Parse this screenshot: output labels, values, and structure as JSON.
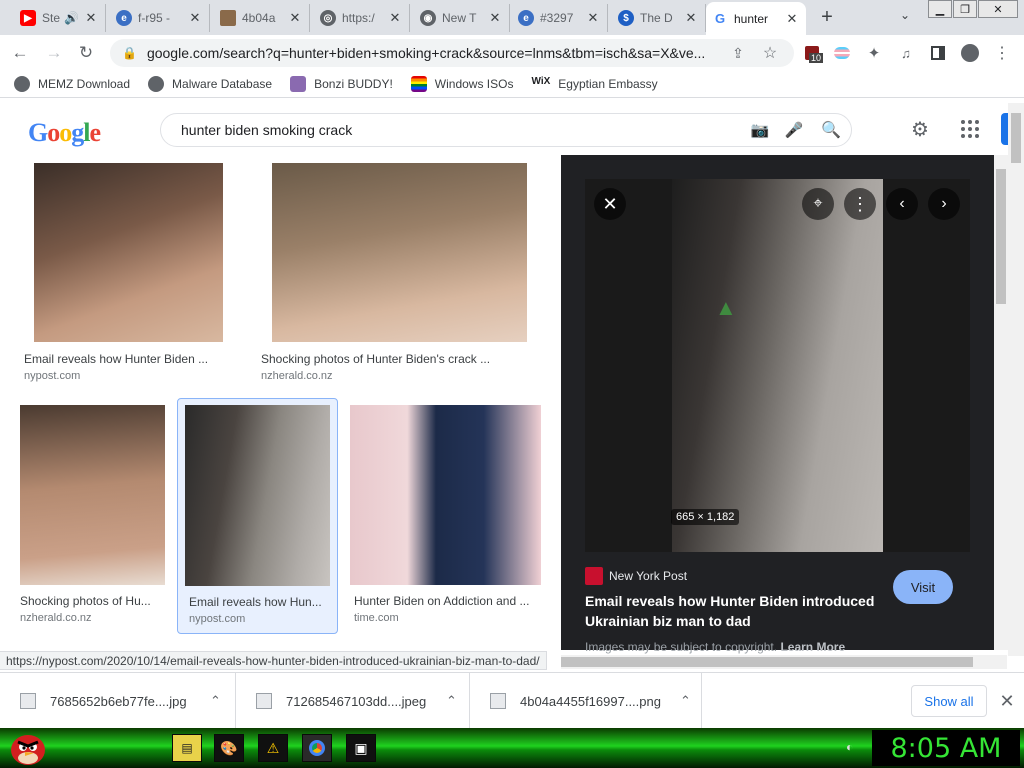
{
  "browser": {
    "tabs": [
      {
        "title": "Ste",
        "icon": "youtube-icon"
      },
      {
        "title": "f-r95 -",
        "icon": "site-icon"
      },
      {
        "title": "4b04a",
        "icon": "image-icon"
      },
      {
        "title": "https:/",
        "icon": "globe-icon"
      },
      {
        "title": "New T",
        "icon": "chrome-icon"
      },
      {
        "title": "#3297",
        "icon": "site-icon"
      },
      {
        "title": "The D",
        "icon": "dollar-icon"
      },
      {
        "title": "hunter",
        "icon": "google-icon"
      }
    ],
    "url": "google.com/search?q=hunter+biden+smoking+crack&source=lnms&tbm=isch&sa=X&ve...",
    "extension_badge": "10",
    "bookmarks": [
      {
        "label": "MEMZ Download"
      },
      {
        "label": "Malware Database"
      },
      {
        "label": "Bonzi BUDDY!"
      },
      {
        "label": "Windows ISOs"
      },
      {
        "label": "Egyptian Embassy"
      }
    ]
  },
  "google": {
    "logo": "Google",
    "query": "hunter biden smoking crack"
  },
  "results": [
    {
      "caption": "Email reveals how Hunter Biden ...",
      "source": "nypost.com"
    },
    {
      "caption": "Shocking photos of Hunter Biden's crack ...",
      "source": "nzherald.co.nz"
    },
    {
      "caption": "Shocking photos of Hu...",
      "source": "nzherald.co.nz"
    },
    {
      "caption": "Email reveals how Hun...",
      "source": "nypost.com"
    },
    {
      "caption": "Hunter Biden on Addiction and ...",
      "source": "time.com"
    }
  ],
  "preview": {
    "dimensions": "665 × 1,182",
    "source": "New York Post",
    "title": "Email reveals how Hunter Biden introduced Ukrainian biz man to dad",
    "visit": "Visit",
    "copyright": "Images may be subject to copyright.",
    "learn_more": "Learn More"
  },
  "status_link": "https://nypost.com/2020/10/14/email-reveals-how-hunter-biden-introduced-ukrainian-biz-man-to-dad/",
  "downloads": {
    "items": [
      {
        "name": "7685652b6eb77fe....jpg"
      },
      {
        "name": "712685467103dd....jpeg"
      },
      {
        "name": "4b04a4455f16997....png"
      }
    ],
    "show_all": "Show all"
  },
  "taskbar": {
    "clock": "8:05 AM"
  },
  "colors": {
    "google_blue": "#4285f4",
    "visit_button": "#8ab4f8",
    "taskbar_green": "#1fd21f",
    "clock_text": "#35e535"
  }
}
